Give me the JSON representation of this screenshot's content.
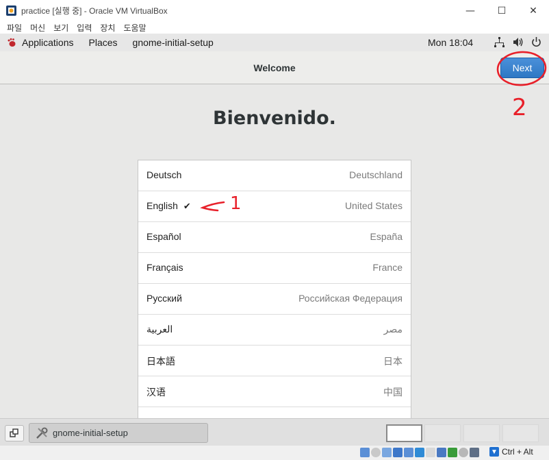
{
  "window": {
    "title": "practice [실행 중] - Oracle VM VirtualBox",
    "minimize_icon": "minimize-icon",
    "maximize_icon": "maximize-icon",
    "close_icon": "close-icon"
  },
  "host_menu": {
    "items": [
      "파일",
      "머신",
      "보기",
      "입력",
      "장치",
      "도움말"
    ]
  },
  "gnome_topbar": {
    "applications": "Applications",
    "places": "Places",
    "active_app": "gnome-initial-setup",
    "clock": "Mon 18:04",
    "icons": [
      "network-icon",
      "volume-icon",
      "power-icon"
    ]
  },
  "header": {
    "title": "Welcome",
    "next_label": "Next"
  },
  "main": {
    "heading": "Bienvenido.",
    "languages": [
      {
        "name": "Deutsch",
        "region": "Deutschland",
        "selected": false
      },
      {
        "name": "English",
        "region": "United States",
        "selected": true,
        "check": "✔"
      },
      {
        "name": "Español",
        "region": "España",
        "selected": false
      },
      {
        "name": "Français",
        "region": "France",
        "selected": false
      },
      {
        "name": "Русский",
        "region": "Российская Федерация",
        "selected": false
      },
      {
        "name": "العربية",
        "region": "مصر",
        "selected": false
      },
      {
        "name": "日本語",
        "region": "日本",
        "selected": false
      },
      {
        "name": "汉语",
        "region": "中国",
        "selected": false
      }
    ],
    "more_indicator": "⋮"
  },
  "annotations": {
    "mark_1": "1",
    "mark_2": "2",
    "color": "#e8202a"
  },
  "taskbar": {
    "task_label": "gnome-initial-setup"
  },
  "host_status": {
    "host_key": "Ctrl + Alt"
  },
  "colors": {
    "accent": "#3584e4",
    "annotation": "#e8202a"
  }
}
